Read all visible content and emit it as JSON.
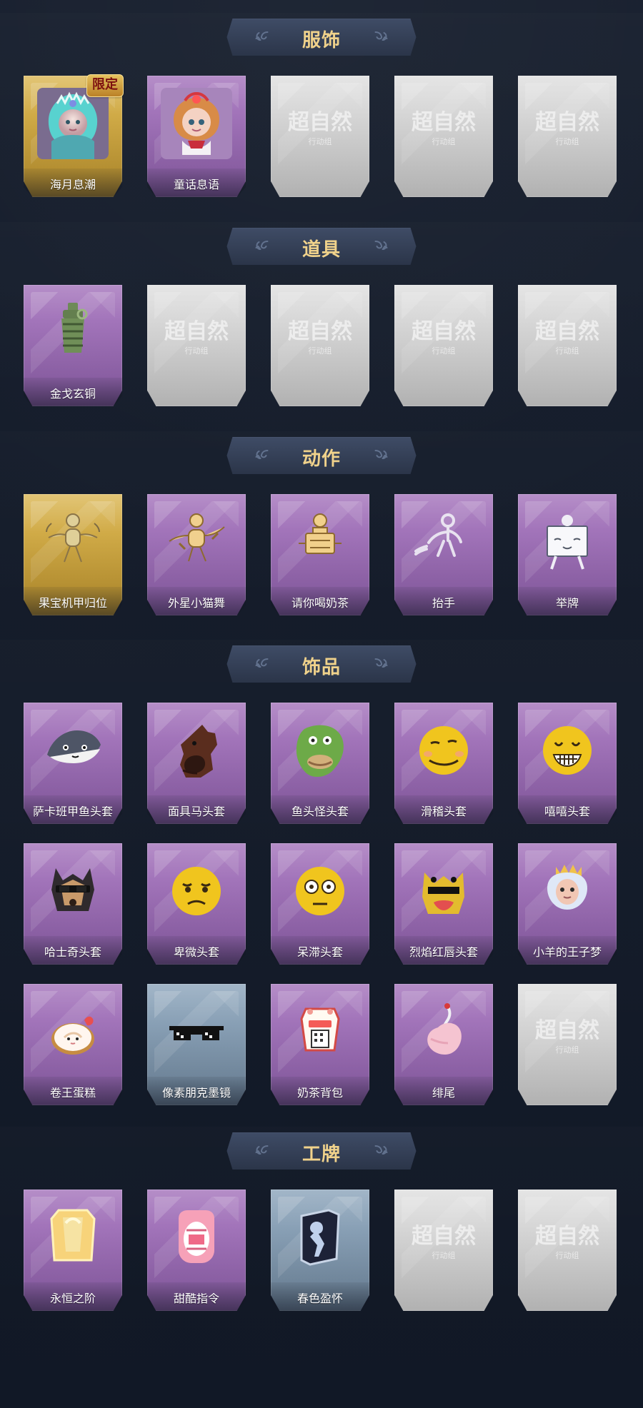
{
  "sections": [
    {
      "title": "服饰",
      "rows": [
        [
          {
            "label": "海月息潮",
            "theme": "gold",
            "icon": "sea-maiden-portrait-icon",
            "badge": "限定"
          },
          {
            "label": "童话息语",
            "theme": "purple",
            "icon": "fairy-girl-portrait-icon"
          },
          {
            "label": "",
            "theme": "locked",
            "icon": "locked-watermark-icon"
          },
          {
            "label": "",
            "theme": "locked",
            "icon": "locked-watermark-icon"
          },
          {
            "label": "",
            "theme": "locked",
            "icon": "locked-watermark-icon"
          }
        ]
      ]
    },
    {
      "title": "道具",
      "rows": [
        [
          {
            "label": "金戈玄铜",
            "theme": "purple",
            "icon": "bronze-grenade-icon"
          },
          {
            "label": "",
            "theme": "locked",
            "icon": "locked-watermark-icon"
          },
          {
            "label": "",
            "theme": "locked",
            "icon": "locked-watermark-icon"
          },
          {
            "label": "",
            "theme": "locked",
            "icon": "locked-watermark-icon"
          },
          {
            "label": "",
            "theme": "locked",
            "icon": "locked-watermark-icon"
          }
        ]
      ]
    },
    {
      "title": "动作",
      "rows": [
        [
          {
            "label": "果宝机甲归位",
            "theme": "gold",
            "icon": "robot-pose-icon"
          },
          {
            "label": "外星小猫舞",
            "theme": "purple",
            "icon": "cat-dance-pose-icon"
          },
          {
            "label": "请你喝奶茶",
            "theme": "purple",
            "icon": "milk-tea-pose-icon"
          },
          {
            "label": "抬手",
            "theme": "purple",
            "icon": "raise-hand-pose-icon"
          },
          {
            "label": "举牌",
            "theme": "purple",
            "icon": "hold-sign-pose-icon"
          }
        ]
      ]
    },
    {
      "title": "饰品",
      "rows": [
        [
          {
            "label": "萨卡班甲鱼头套",
            "theme": "purple",
            "icon": "fish-head-icon"
          },
          {
            "label": "面具马头套",
            "theme": "purple",
            "icon": "horse-head-icon"
          },
          {
            "label": "鱼头怪头套",
            "theme": "purple",
            "icon": "green-fish-mask-icon"
          },
          {
            "label": "滑稽头套",
            "theme": "purple",
            "icon": "smirk-face-icon"
          },
          {
            "label": "嘻嘻头套",
            "theme": "purple",
            "icon": "grin-face-icon"
          }
        ],
        [
          {
            "label": "哈士奇头套",
            "theme": "purple",
            "icon": "husky-head-icon"
          },
          {
            "label": "卑微头套",
            "theme": "purple",
            "icon": "sad-face-icon"
          },
          {
            "label": "呆滞头套",
            "theme": "purple",
            "icon": "dazed-face-icon"
          },
          {
            "label": "烈焰红唇头套",
            "theme": "purple",
            "icon": "red-lips-mask-icon"
          },
          {
            "label": "小羊的王子梦",
            "theme": "purple",
            "icon": "sheep-crown-icon"
          }
        ],
        [
          {
            "label": "卷王蛋糕",
            "theme": "purple",
            "icon": "cake-roll-icon"
          },
          {
            "label": "像素朋克墨镜",
            "theme": "blue",
            "icon": "pixel-sunglasses-icon"
          },
          {
            "label": "奶茶背包",
            "theme": "purple",
            "icon": "milk-tea-backpack-icon"
          },
          {
            "label": "绯尾",
            "theme": "purple",
            "icon": "pink-tail-icon"
          },
          {
            "label": "",
            "theme": "locked",
            "icon": "locked-watermark-icon"
          }
        ]
      ]
    },
    {
      "title": "工牌",
      "rows": [
        [
          {
            "label": "永恒之阶",
            "theme": "purple",
            "icon": "golden-card-icon"
          },
          {
            "label": "甜酷指令",
            "theme": "purple",
            "icon": "pink-mouth-card-icon"
          },
          {
            "label": "春色盈怀",
            "theme": "blue",
            "icon": "silhouette-card-icon"
          },
          {
            "label": "",
            "theme": "locked",
            "icon": "locked-watermark-icon"
          },
          {
            "label": "",
            "theme": "locked",
            "icon": "locked-watermark-icon"
          }
        ]
      ]
    }
  ],
  "watermark": {
    "title": "超自然",
    "subtitle": "行动组"
  }
}
